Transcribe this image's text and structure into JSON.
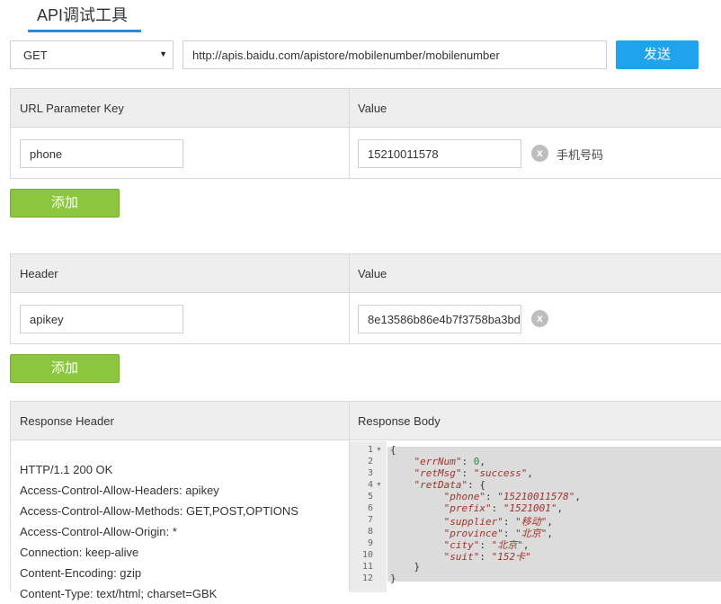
{
  "tab": {
    "title": "API调试工具"
  },
  "request": {
    "method": "GET",
    "url": "http://apis.baidu.com/apistore/mobilenumber/mobilenumber",
    "send_label": "发送"
  },
  "params": {
    "col_key": "URL Parameter Key",
    "col_value": "Value",
    "rows": [
      {
        "key": "phone",
        "value": "15210011578",
        "clear": "x",
        "hint": "手机号码"
      }
    ],
    "add_label": "添加"
  },
  "headers": {
    "col_key": "Header",
    "col_value": "Value",
    "rows": [
      {
        "key": "apikey",
        "value": "8e13586b86e4b7f3758ba3bd",
        "clear": "x"
      }
    ],
    "add_label": "添加"
  },
  "response": {
    "col_header": "Response Header",
    "col_body": "Response Body",
    "header_lines": [
      "HTTP/1.1 200 OK",
      "Access-Control-Allow-Headers: apikey",
      "Access-Control-Allow-Methods: GET,POST,OPTIONS",
      "Access-Control-Allow-Origin: *",
      "Connection: keep-alive",
      "Content-Encoding: gzip",
      "Content-Type: text/html; charset=GBK"
    ],
    "body": {
      "open": "{",
      "errNum_key": "\"errNum\"",
      "errNum_val": "0",
      "retMsg_key": "\"retMsg\"",
      "retMsg_val": "\"success\"",
      "retData_key": "\"retData\"",
      "retData_open": "{",
      "phone_key": "\"phone\"",
      "phone_val": "\"15210011578\"",
      "prefix_key": "\"prefix\"",
      "prefix_val": "\"1521001\"",
      "supplier_key": "\"supplier\"",
      "supplier_val": "\"移动\"",
      "province_key": "\"province\"",
      "province_val": "\"北京\"",
      "city_key": "\"city\"",
      "city_val": "\"北京\"",
      "suit_key": "\"suit\"",
      "suit_val": "\"152卡\"",
      "inner_close": "}",
      "close": "}"
    },
    "line_numbers": [
      "1",
      "2",
      "3",
      "4",
      "5",
      "6",
      "7",
      "8",
      "9",
      "10",
      "11",
      "12"
    ]
  }
}
